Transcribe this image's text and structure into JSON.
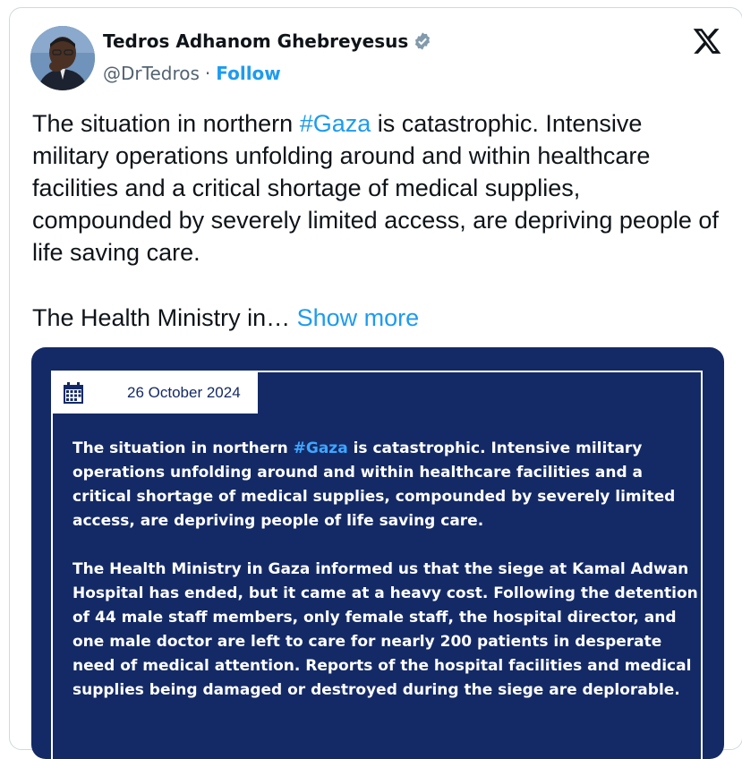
{
  "author": {
    "name": "Tedros Adhanom Ghebreyesus",
    "handle": "@DrTedros",
    "separator": "·",
    "follow_label": "Follow",
    "verified_icon": "verified-badge-icon"
  },
  "brand": {
    "logo": "x-logo-icon"
  },
  "tweet": {
    "text_before": "The situation in northern ",
    "hashtag": "#Gaza",
    "text_after": " is catastrophic. Intensive military operations unfolding around and within healthcare facilities and a critical shortage of medical supplies, compounded by severely limited access, are depriving people of life saving care.",
    "second_para": "The Health Ministry in…",
    "show_more": "Show more"
  },
  "media": {
    "date": "26 October 2024",
    "calendar_icon": "calendar-icon",
    "para1_before": "The situation in northern ",
    "para1_hashtag": "#Gaza",
    "para1_after": " is catastrophic. Intensive military operations unfolding around and within healthcare facilities and a critical shortage of medical supplies, compounded by severely limited access, are depriving people of life saving care.",
    "para2": "The Health Ministry in Gaza informed us that the siege at Kamal Adwan Hospital has ended, but it came at a heavy cost. Following the detention of 44 male staff members, only female staff, the hospital director, and one male doctor are left to care for nearly 200 patients in desperate need of medical attention. Reports of the hospital facilities and medical supplies being damaged or destroyed during the siege are deplorable."
  },
  "colors": {
    "link": "#1d9bf0",
    "media_background": "#142a66",
    "text": "#0f1419",
    "secondary": "#536471"
  }
}
